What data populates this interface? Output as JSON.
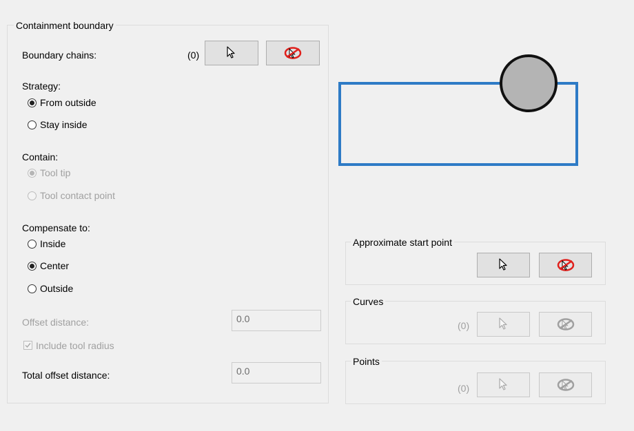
{
  "containment": {
    "title": "Containment boundary",
    "boundary_chains_label": "Boundary chains:",
    "boundary_chains_count": "(0)",
    "strategy": {
      "label": "Strategy:",
      "options": [
        {
          "label": "From outside",
          "checked": true
        },
        {
          "label": "Stay inside",
          "checked": false
        }
      ]
    },
    "contain": {
      "label": "Contain:",
      "options": [
        {
          "label": "Tool tip",
          "checked": true,
          "disabled": true
        },
        {
          "label": "Tool contact point",
          "checked": false,
          "disabled": true
        }
      ]
    },
    "compensate": {
      "label": "Compensate to:",
      "options": [
        {
          "label": "Inside",
          "checked": false
        },
        {
          "label": "Center",
          "checked": true
        },
        {
          "label": "Outside",
          "checked": false
        }
      ]
    },
    "offset_distance_label": "Offset distance:",
    "offset_distance_value": "0.0",
    "include_tool_radius_label": "Include tool radius",
    "include_tool_radius_checked": true,
    "total_offset_label": "Total offset distance:",
    "total_offset_value": "0.0"
  },
  "start_point": {
    "title": "Approximate start point"
  },
  "curves": {
    "title": "Curves",
    "count": "(0)"
  },
  "points": {
    "title": "Points",
    "count": "(0)"
  },
  "icons": {
    "select": "arrow-cursor-icon",
    "clear": "clear-selection-icon"
  },
  "colors": {
    "boundary_rect": "#2e7bc6",
    "tool_circle_fill": "#b4b4b4",
    "clear_icon_red": "#e0201c",
    "disabled_text": "#a0a0a0"
  }
}
